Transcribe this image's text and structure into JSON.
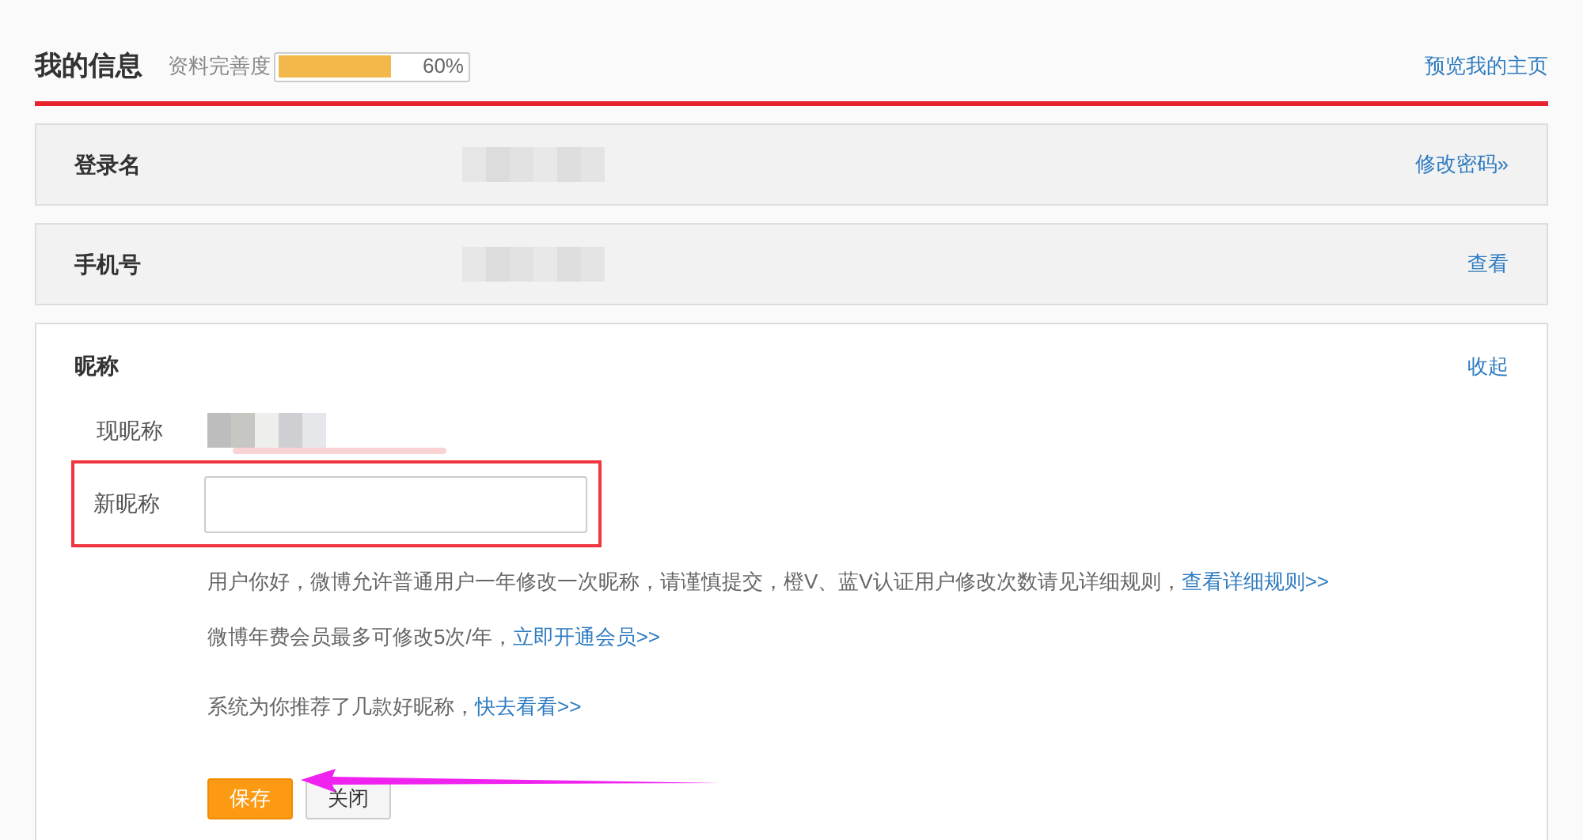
{
  "header": {
    "title": "我的信息",
    "completeness_label": "资料完善度",
    "completeness": {
      "level": 0.6,
      "reading": "60%"
    },
    "preview_link": "预览我的主页"
  },
  "rows": [
    {
      "label": "登录名",
      "action": "修改密码»"
    },
    {
      "label": "手机号",
      "action": "查看"
    }
  ],
  "nickname": {
    "title": "昵称",
    "collapse": "收起",
    "current_label": "现昵称",
    "new_label": "新昵称",
    "notes": [
      {
        "text": "用户你好，微博允许普通用户一年修改一次昵称，请谨慎提交，橙V、蓝V认证用户修改次数请见详细规则，",
        "link": "查看详细规则>>"
      },
      {
        "text": "微博年费会员最多可修改5次/年，",
        "link": "立即开通会员>>"
      },
      {
        "text": "系统为你推荐了几款好昵称，",
        "link": "快去看看>>"
      }
    ],
    "buttons": [
      {
        "label": "保存",
        "kind": "primary"
      },
      {
        "label": "关闭",
        "kind": "secondary"
      }
    ]
  }
}
